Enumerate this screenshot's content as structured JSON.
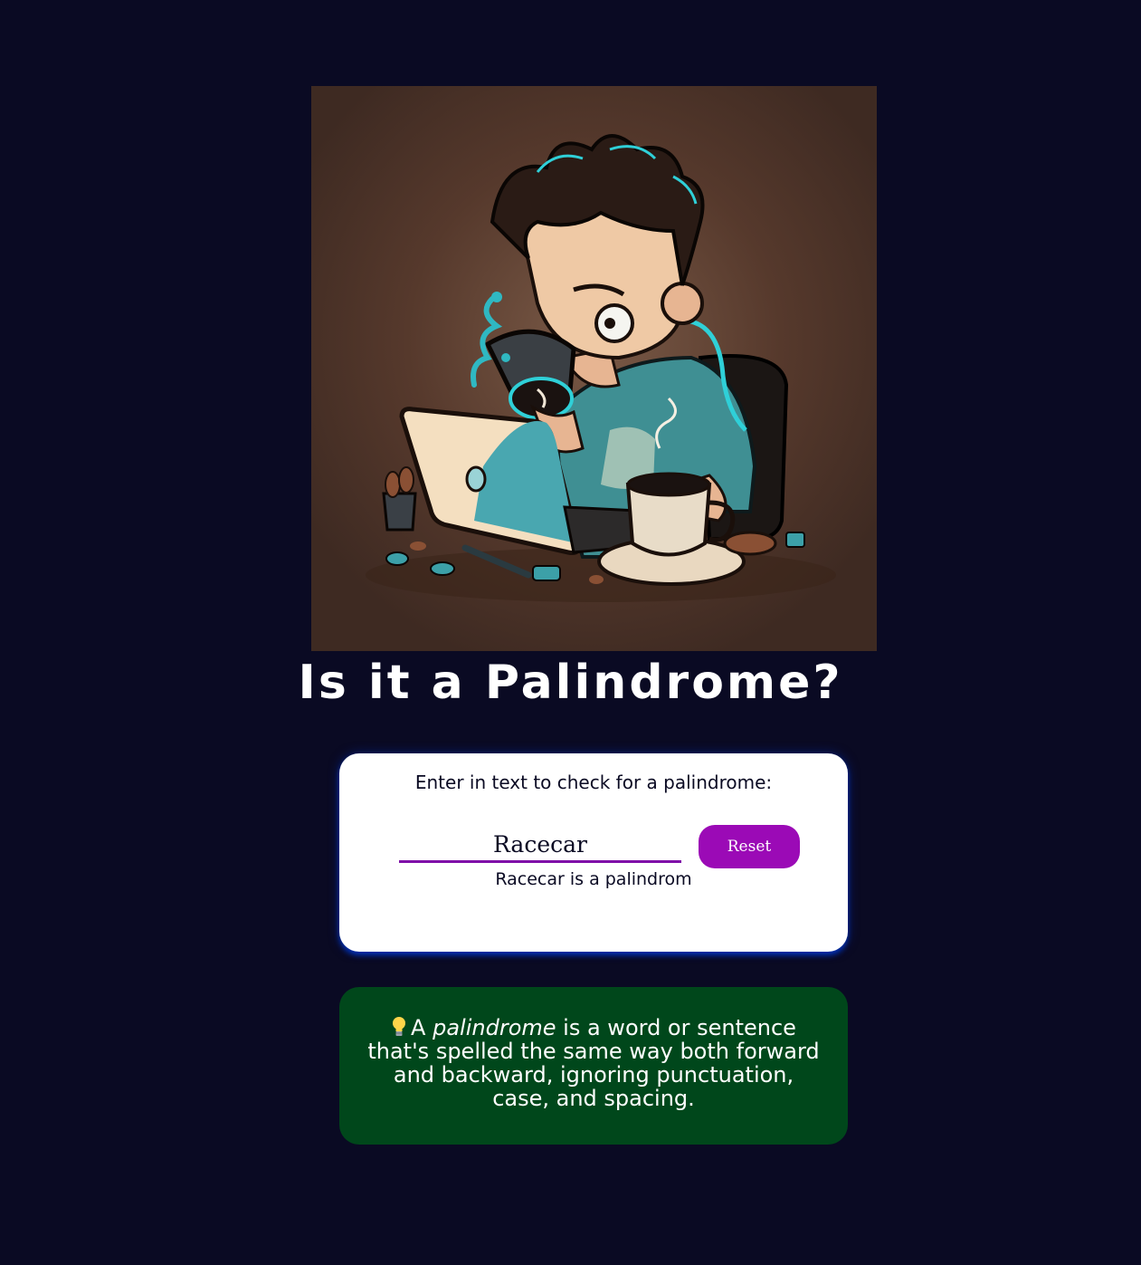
{
  "page": {
    "title": "Is it a Palindrome?"
  },
  "checker": {
    "label": "Enter in text to check for a palindrome:",
    "input_value": "Racecar",
    "reset_label": "Reset",
    "result_text": "Racecar is a palindrom"
  },
  "info": {
    "icon": "lightbulb-icon",
    "lead": "A",
    "term": "palindrome",
    "definition": "is a word or sentence that's spelled the same way both forward and backward, ignoring punctuation, case, and spacing."
  },
  "colors": {
    "background": "#0a0a23",
    "card": "#ffffff",
    "accent_purple": "#9b0ab6",
    "info_green": "#00471b",
    "card_shadow": "#002ead"
  }
}
